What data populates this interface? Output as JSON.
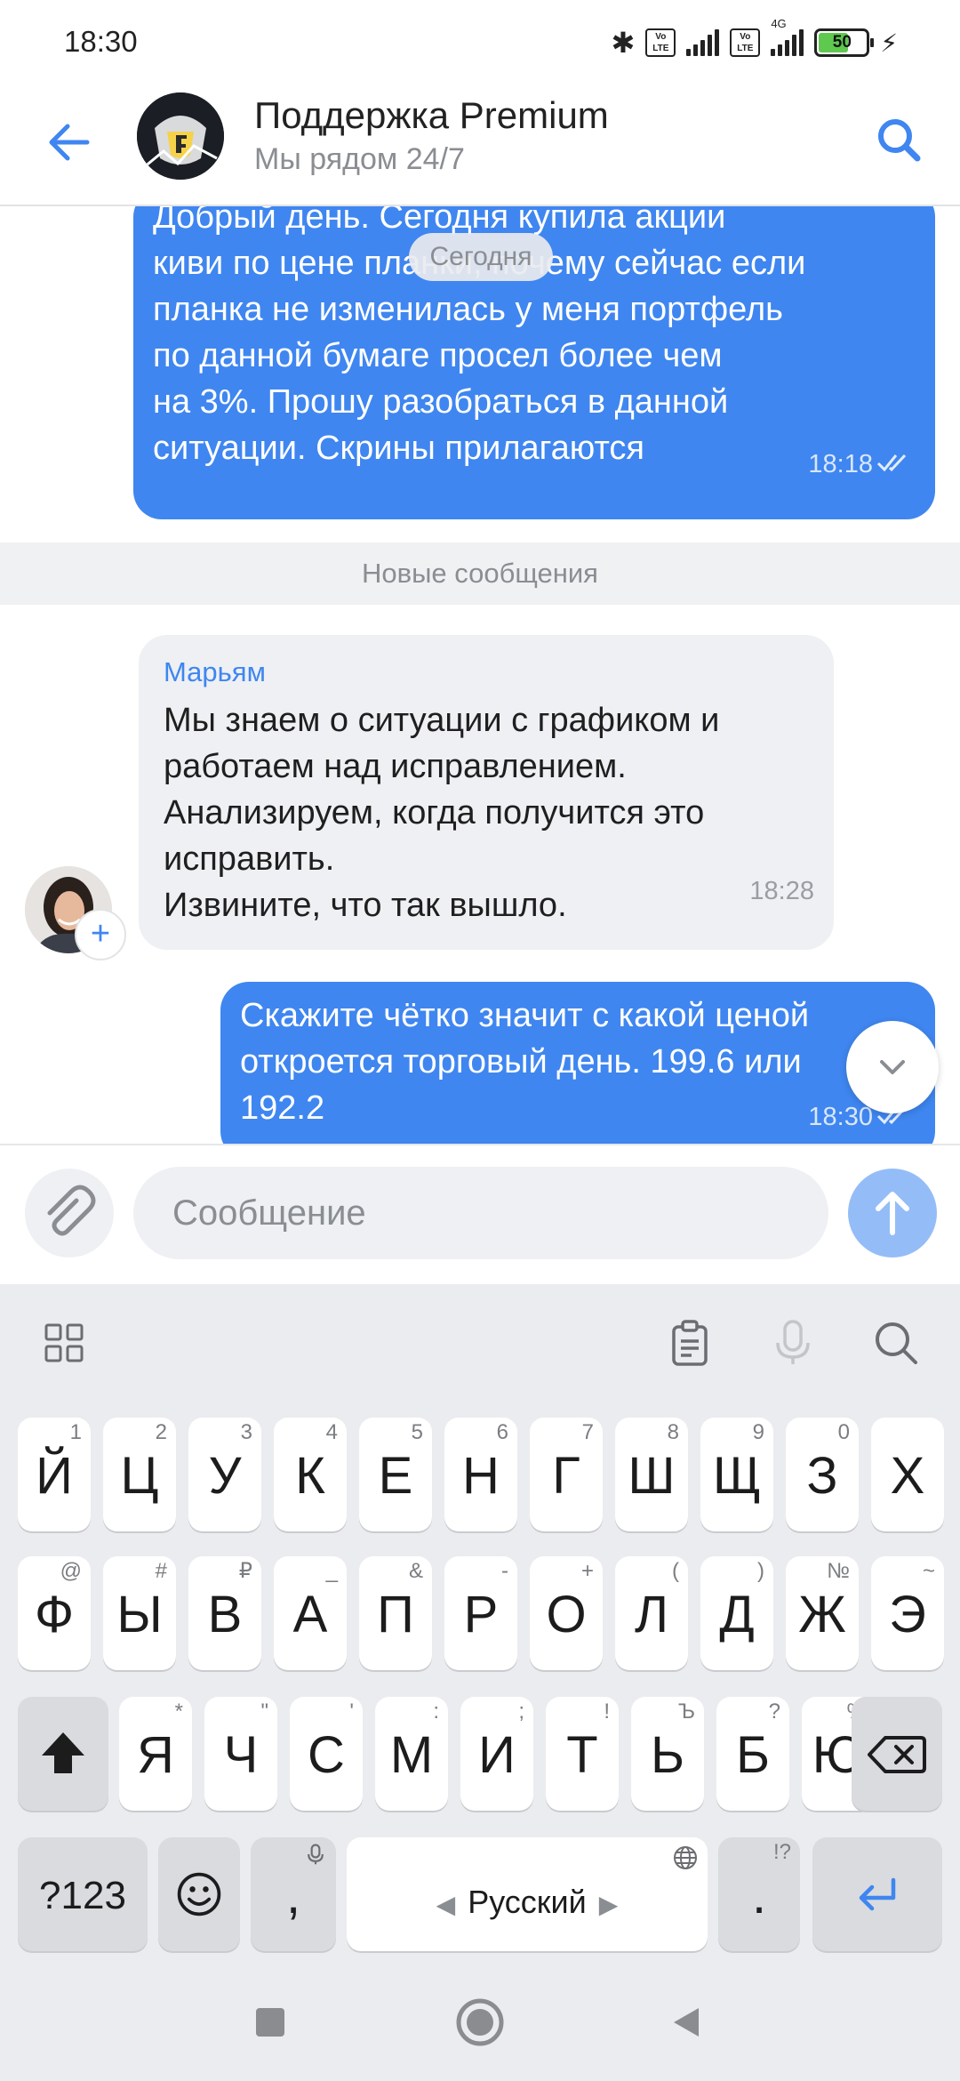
{
  "status_bar": {
    "time": "18:30",
    "network_label": "4G",
    "battery_level": "50",
    "icons": [
      "bluetooth-icon",
      "volte-icon",
      "signal-icon",
      "battery-icon",
      "charging-icon"
    ]
  },
  "header": {
    "title": "Поддержка Premium",
    "subtitle": "Мы рядом 24/7"
  },
  "chat": {
    "date_label": "Сегодня",
    "new_messages_label": "Новые сообщения",
    "messages": [
      {
        "direction": "outgoing",
        "text": "Добрый день. Сегодня купила акции\nкиви по цене планки, почему сейчас если\nпланка не изменилась у меня портфель\nпо данной бумаге просел более чем\nна 3%. Прошу разобраться в данной\nситуации. Скрины прилагаются",
        "time": "18:18",
        "status": "read"
      },
      {
        "direction": "incoming",
        "sender": "Марьям",
        "text": "Мы знаем о ситуации с графиком и\nработаем над исправлением.\nАнализируем, когда получится это\nисправить.\nИзвините, что так вышло.",
        "time": "18:28"
      },
      {
        "direction": "outgoing",
        "text": "Скажите чётко значит с какой ценой\nоткроется торговый день. 199.6 или\n192.2",
        "time": "18:30",
        "status": "read"
      }
    ]
  },
  "composer": {
    "placeholder": "Сообщение"
  },
  "keyboard": {
    "row1": [
      {
        "label": "Й",
        "hint": "1"
      },
      {
        "label": "Ц",
        "hint": "2"
      },
      {
        "label": "У",
        "hint": "3"
      },
      {
        "label": "К",
        "hint": "4"
      },
      {
        "label": "Е",
        "hint": "5"
      },
      {
        "label": "Н",
        "hint": "6"
      },
      {
        "label": "Г",
        "hint": "7"
      },
      {
        "label": "Ш",
        "hint": "8"
      },
      {
        "label": "Щ",
        "hint": "9"
      },
      {
        "label": "З",
        "hint": "0"
      },
      {
        "label": "Х",
        "hint": ""
      }
    ],
    "row2": [
      {
        "label": "Ф",
        "hint": "@"
      },
      {
        "label": "Ы",
        "hint": "#"
      },
      {
        "label": "В",
        "hint": "₽"
      },
      {
        "label": "А",
        "hint": "_"
      },
      {
        "label": "П",
        "hint": "&"
      },
      {
        "label": "Р",
        "hint": "-"
      },
      {
        "label": "О",
        "hint": "+"
      },
      {
        "label": "Л",
        "hint": "("
      },
      {
        "label": "Д",
        "hint": ")"
      },
      {
        "label": "Ж",
        "hint": "№"
      },
      {
        "label": "Э",
        "hint": "~"
      }
    ],
    "row3": [
      {
        "label": "Я",
        "hint": "*"
      },
      {
        "label": "Ч",
        "hint": "\""
      },
      {
        "label": "С",
        "hint": "'"
      },
      {
        "label": "М",
        "hint": ":"
      },
      {
        "label": "И",
        "hint": ";"
      },
      {
        "label": "Т",
        "hint": "!"
      },
      {
        "label": "Ь",
        "hint": "Ъ"
      },
      {
        "label": "Б",
        "hint": "?"
      },
      {
        "label": "Ю",
        "hint": "%"
      }
    ],
    "symbols_key": "?123",
    "comma_key": ",",
    "space_key": "Русский",
    "period_key": ".",
    "period_hint": "!?"
  }
}
